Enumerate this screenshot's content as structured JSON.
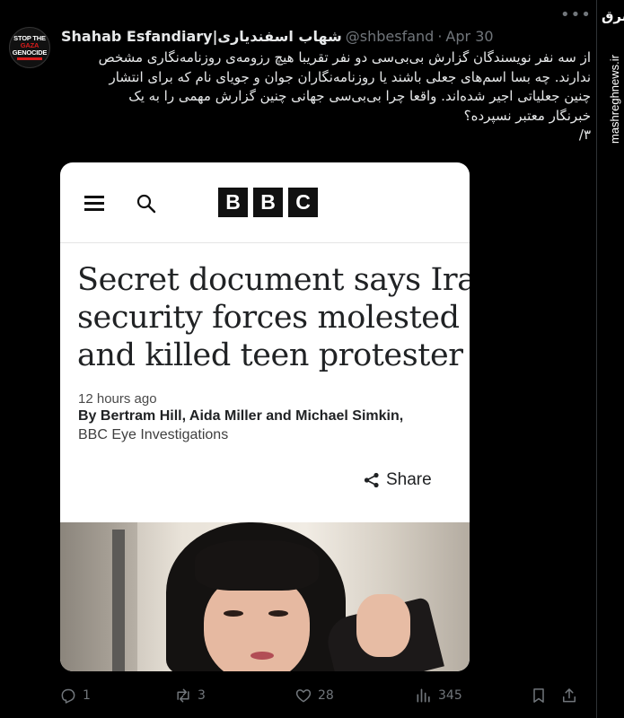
{
  "tweet": {
    "avatar_text": [
      "STOP THE",
      "GAZA",
      "GENOCIDE"
    ],
    "display_name": "Shahab Esfandiary|شهاب اسفندیاری",
    "handle": "@shbesfand",
    "dot": "·",
    "date": "Apr 30",
    "text_lines": [
      "از سه نفر نویسندگان گزارش بی‌بی‌سی دو نفر تقریبا هیچ رزومه‌ی روزنامه‌نگاری مشخص",
      "ندارند. چه بسا اسم‌های جعلی باشند یا روزنامه‌نگاران جوان و جویای نام که برای انتشار",
      "چنین جعلیاتی اجیر شده‌اند. واقعا چرا بی‌بی‌سی جهانی چنین گزارش مهمی را به یک",
      "خبرنگار معتبر نسپرده؟",
      "۳/"
    ]
  },
  "card": {
    "logo_letters": [
      "B",
      "B",
      "C"
    ],
    "headline_lines": [
      "Secret document says Iran",
      "security forces molested",
      "and killed teen protester"
    ],
    "time_ago": "12 hours ago",
    "byline": "By Bertram Hill, Aida Miller and Michael Simkin,",
    "unit": "BBC Eye Investigations",
    "share_label": "Share"
  },
  "actions": {
    "replies": "1",
    "retweets": "3",
    "likes": "28",
    "views": "345"
  },
  "watermark": {
    "logo": "مشرق",
    "text": "mashreghnews.ir"
  },
  "colors": {
    "background": "#000000",
    "muted": "#71767b",
    "card_bg": "#ffffff",
    "bbc_black": "#111111"
  }
}
